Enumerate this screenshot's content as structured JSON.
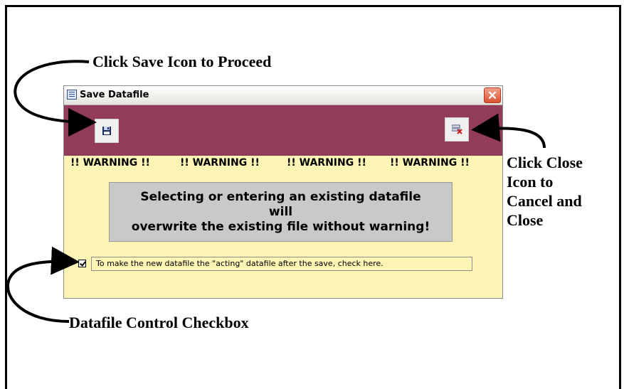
{
  "annotations": {
    "save_hint": "Click Save Icon to Proceed",
    "close_hint_lines": [
      "Click Close",
      "Icon to",
      "Cancel and",
      "Close"
    ],
    "checkbox_hint": "Datafile Control Checkbox"
  },
  "window": {
    "title": "Save Datafile",
    "banner_color": "#933b5b",
    "body_color": "#fbf4b5",
    "warnings": [
      "!! WARNING !!",
      "!! WARNING !!",
      "!! WARNING !!",
      "!! WARNING !!"
    ],
    "message_lines": [
      "Selecting or entering an existing datafile will",
      "overwrite the existing file without warning!"
    ],
    "checkbox": {
      "checked": true,
      "label": "To make the new datafile the \"acting\" datafile after the save,  check here."
    },
    "icons": {
      "app": "table-icon",
      "save": "floppy-disk-icon",
      "close": "close-datafile-icon",
      "window_close": "close-icon"
    }
  }
}
